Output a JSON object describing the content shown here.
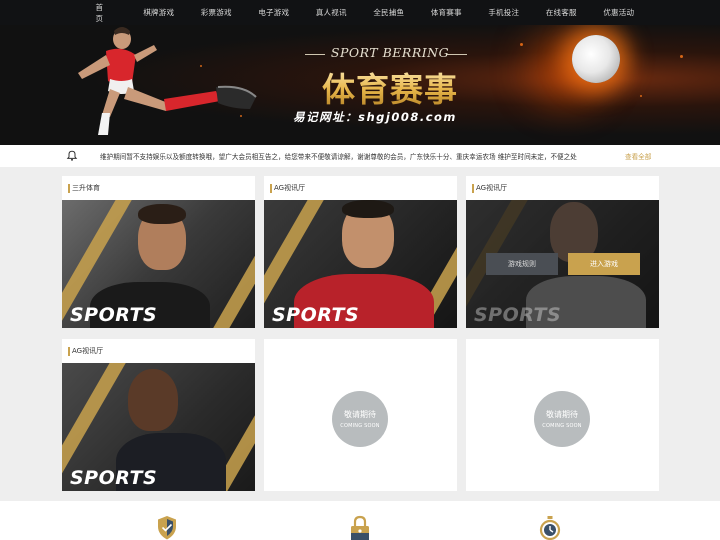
{
  "nav": {
    "items": [
      "首　　页",
      "棋牌游戏",
      "彩票游戏",
      "电子游戏",
      "真人视讯",
      "全民捕鱼",
      "体育赛事",
      "手机投注",
      "在线客服",
      "优惠活动"
    ]
  },
  "banner": {
    "tagline": "SPORT BERRING",
    "title": "体育赛事",
    "url_text": "易记网址：shgj008.com"
  },
  "notice": {
    "icon": "bell-icon",
    "text": "维护期间暂不支持娱乐以及额度转换哦，望广大会员相互告之，给您带来不便敬请谅解，谢谢尊敬的会员，广东快乐十分、重庆幸运农场 维护至时间未定，不便之处",
    "more": "查看全部"
  },
  "cards": [
    {
      "title": "三升体育",
      "image_text": "SPORTS"
    },
    {
      "title": "AG视讯厅",
      "image_text": "SPORTS"
    },
    {
      "title": "AG视讯厅",
      "image_text": "SPORTS",
      "btn_rules": "游戏规则",
      "btn_enter": "进入游戏"
    },
    {
      "title": "AG视讯厅",
      "image_text": "SPORTS"
    },
    {
      "coming_cn": "敬请期待",
      "coming_en": "COMING SOON"
    },
    {
      "coming_cn": "敬请期待",
      "coming_en": "COMING SOON"
    }
  ],
  "footer": {
    "icons": [
      "shield-check-icon",
      "padlock-icon",
      "stopwatch-icon"
    ]
  },
  "colors": {
    "accent_gold": "#c9a24e",
    "nav_bg": "#111214",
    "coming_soon_circle": "#b8bcbe"
  }
}
